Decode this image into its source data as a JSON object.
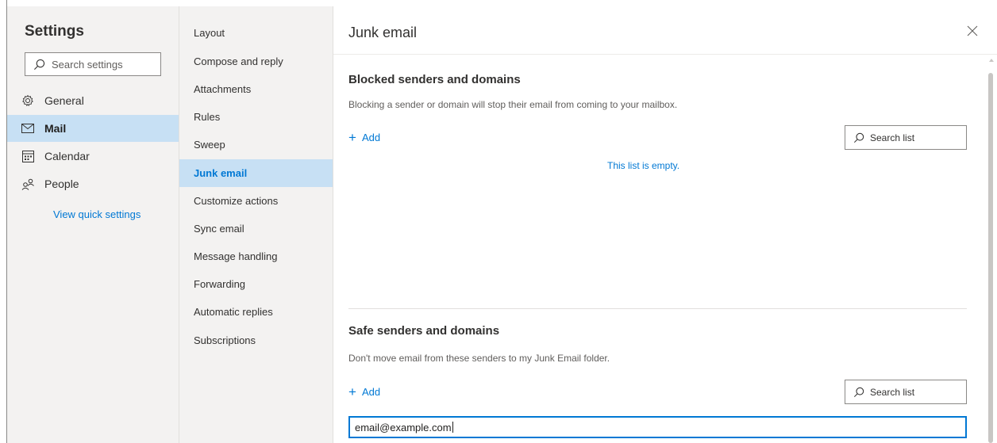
{
  "settings": {
    "title": "Settings",
    "search_placeholder": "Search settings",
    "nav": [
      {
        "label": "General",
        "icon": "gear-icon"
      },
      {
        "label": "Mail",
        "icon": "mail-icon"
      },
      {
        "label": "Calendar",
        "icon": "calendar-icon"
      },
      {
        "label": "People",
        "icon": "people-icon"
      }
    ],
    "quick_settings_link": "View quick settings"
  },
  "categories": [
    "Layout",
    "Compose and reply",
    "Attachments",
    "Rules",
    "Sweep",
    "Junk email",
    "Customize actions",
    "Sync email",
    "Message handling",
    "Forwarding",
    "Automatic replies",
    "Subscriptions"
  ],
  "selected_category": "Junk email",
  "panel": {
    "title": "Junk email",
    "blocked": {
      "title": "Blocked senders and domains",
      "description": "Blocking a sender or domain will stop their email from coming to your mailbox.",
      "add_label": "Add",
      "search_placeholder": "Search list",
      "empty_message": "This list is empty."
    },
    "safe": {
      "title": "Safe senders and domains",
      "description": "Don't move email from these senders to my Junk Email folder.",
      "add_label": "Add",
      "search_placeholder": "Search list",
      "input_value": "email@example.com"
    }
  },
  "colors": {
    "accent": "#0078d4",
    "selected_bg": "#c7e0f4",
    "pane_bg": "#f3f2f1"
  }
}
